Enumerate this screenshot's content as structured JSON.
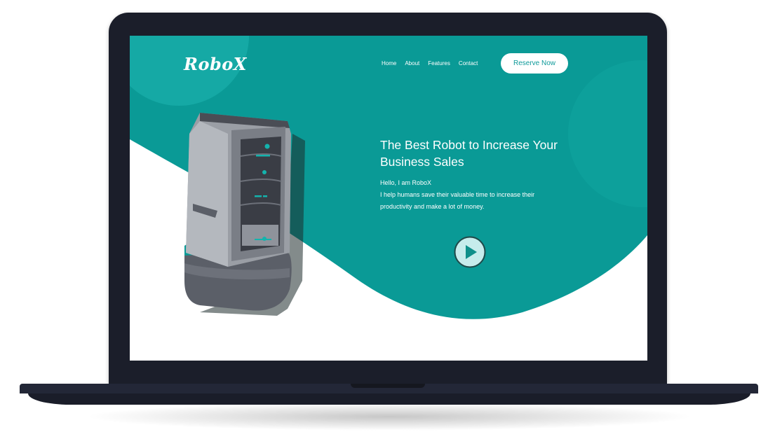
{
  "brand": {
    "logo": "RoboX",
    "accent": "#0a9a96",
    "accent_light": "#16aba6"
  },
  "nav": {
    "items": [
      {
        "label": "Home"
      },
      {
        "label": "About"
      },
      {
        "label": "Features"
      },
      {
        "label": "Contact"
      }
    ],
    "cta_label": "Reserve Now"
  },
  "hero": {
    "title": "The Best Robot to Increase Your Business Sales",
    "greeting": "Hello, I am RoboX",
    "description": "I help humans save their valuable time to increase their productivity and make a lot of money."
  },
  "icons": {
    "play": "play-icon",
    "robot": "robot-illustration"
  }
}
